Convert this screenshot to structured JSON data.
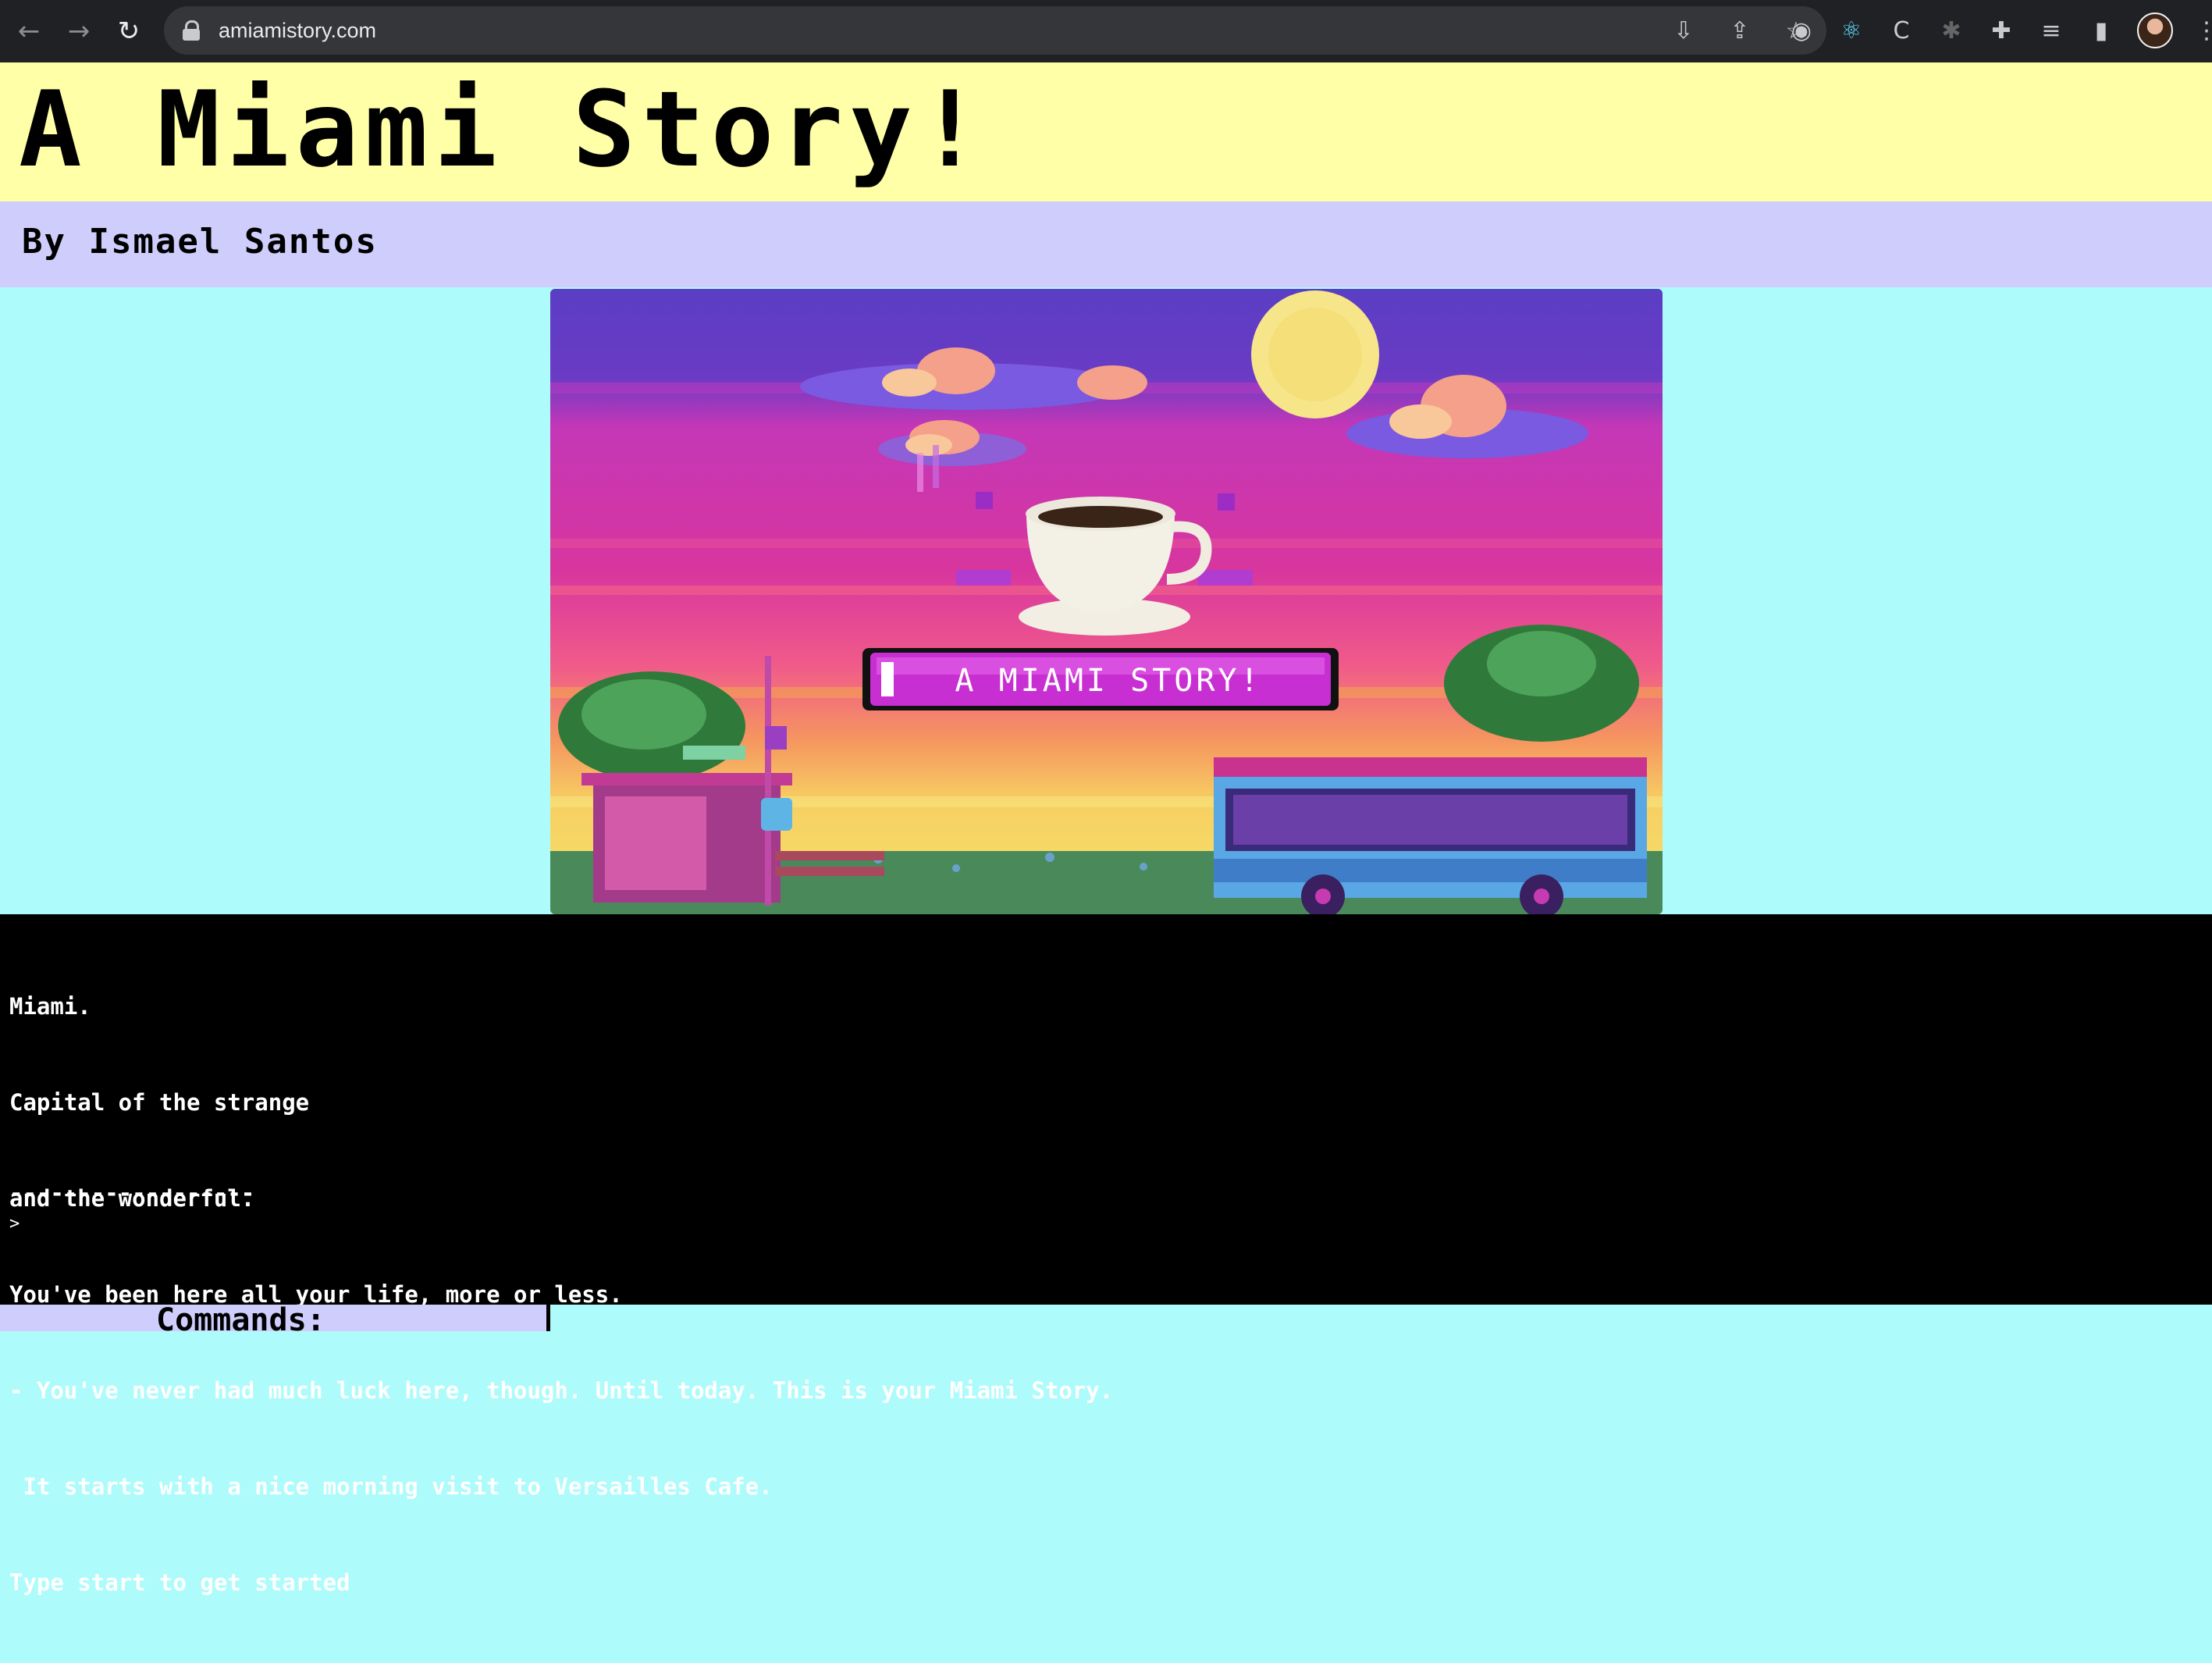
{
  "browser": {
    "url": "amiamistory.com",
    "nav": {
      "back_icon": "←",
      "forward_icon": "→",
      "reload_icon": "↻"
    }
  },
  "header": {
    "title": "A Miami Story!",
    "byline": "By Ismael Santos"
  },
  "banner": {
    "label": "A MIAMI STORY!"
  },
  "terminal": {
    "lines": [
      "Miami.",
      "Capital of the strange",
      "and the wonderful.",
      "You've been here all your life, more or less.",
      "- You've never had much luck here, though. Until today. This is your Miami Story.",
      " It starts with a nice morning visit to Versailles Cafe.",
      "Type start to get started"
    ],
    "divider": "------------------",
    "prompt": ">"
  },
  "commands": {
    "title": "Commands:"
  },
  "colors": {
    "title_band": "#ffffa8",
    "byline_band": "#cfcdfc",
    "page_background": "#aefbfb",
    "terminal_background": "#000000"
  }
}
